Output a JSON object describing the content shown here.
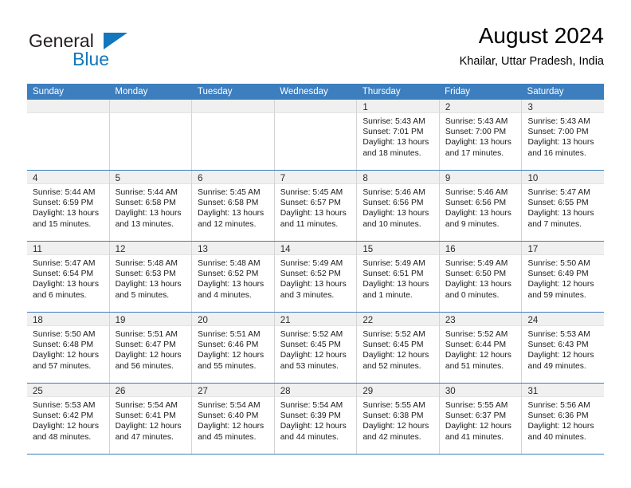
{
  "brand": {
    "name_part1": "General",
    "name_part2": "Blue",
    "logo_icon": "triangle-icon",
    "color_dark": "#231f20",
    "color_blue": "#1277bc"
  },
  "header": {
    "title": "August 2024",
    "subtitle": "Khailar, Uttar Pradesh, India"
  },
  "calendar": {
    "accent_color": "#3d7ebf",
    "daynum_band_color": "#f0f0f0",
    "weekdays": [
      "Sunday",
      "Monday",
      "Tuesday",
      "Wednesday",
      "Thursday",
      "Friday",
      "Saturday"
    ],
    "weeks": [
      [
        {
          "day": "",
          "lines": []
        },
        {
          "day": "",
          "lines": []
        },
        {
          "day": "",
          "lines": []
        },
        {
          "day": "",
          "lines": []
        },
        {
          "day": "1",
          "lines": [
            "Sunrise: 5:43 AM",
            "Sunset: 7:01 PM",
            "Daylight: 13 hours",
            "and 18 minutes."
          ]
        },
        {
          "day": "2",
          "lines": [
            "Sunrise: 5:43 AM",
            "Sunset: 7:00 PM",
            "Daylight: 13 hours",
            "and 17 minutes."
          ]
        },
        {
          "day": "3",
          "lines": [
            "Sunrise: 5:43 AM",
            "Sunset: 7:00 PM",
            "Daylight: 13 hours",
            "and 16 minutes."
          ]
        }
      ],
      [
        {
          "day": "4",
          "lines": [
            "Sunrise: 5:44 AM",
            "Sunset: 6:59 PM",
            "Daylight: 13 hours",
            "and 15 minutes."
          ]
        },
        {
          "day": "5",
          "lines": [
            "Sunrise: 5:44 AM",
            "Sunset: 6:58 PM",
            "Daylight: 13 hours",
            "and 13 minutes."
          ]
        },
        {
          "day": "6",
          "lines": [
            "Sunrise: 5:45 AM",
            "Sunset: 6:58 PM",
            "Daylight: 13 hours",
            "and 12 minutes."
          ]
        },
        {
          "day": "7",
          "lines": [
            "Sunrise: 5:45 AM",
            "Sunset: 6:57 PM",
            "Daylight: 13 hours",
            "and 11 minutes."
          ]
        },
        {
          "day": "8",
          "lines": [
            "Sunrise: 5:46 AM",
            "Sunset: 6:56 PM",
            "Daylight: 13 hours",
            "and 10 minutes."
          ]
        },
        {
          "day": "9",
          "lines": [
            "Sunrise: 5:46 AM",
            "Sunset: 6:56 PM",
            "Daylight: 13 hours",
            "and 9 minutes."
          ]
        },
        {
          "day": "10",
          "lines": [
            "Sunrise: 5:47 AM",
            "Sunset: 6:55 PM",
            "Daylight: 13 hours",
            "and 7 minutes."
          ]
        }
      ],
      [
        {
          "day": "11",
          "lines": [
            "Sunrise: 5:47 AM",
            "Sunset: 6:54 PM",
            "Daylight: 13 hours",
            "and 6 minutes."
          ]
        },
        {
          "day": "12",
          "lines": [
            "Sunrise: 5:48 AM",
            "Sunset: 6:53 PM",
            "Daylight: 13 hours",
            "and 5 minutes."
          ]
        },
        {
          "day": "13",
          "lines": [
            "Sunrise: 5:48 AM",
            "Sunset: 6:52 PM",
            "Daylight: 13 hours",
            "and 4 minutes."
          ]
        },
        {
          "day": "14",
          "lines": [
            "Sunrise: 5:49 AM",
            "Sunset: 6:52 PM",
            "Daylight: 13 hours",
            "and 3 minutes."
          ]
        },
        {
          "day": "15",
          "lines": [
            "Sunrise: 5:49 AM",
            "Sunset: 6:51 PM",
            "Daylight: 13 hours",
            "and 1 minute."
          ]
        },
        {
          "day": "16",
          "lines": [
            "Sunrise: 5:49 AM",
            "Sunset: 6:50 PM",
            "Daylight: 13 hours",
            "and 0 minutes."
          ]
        },
        {
          "day": "17",
          "lines": [
            "Sunrise: 5:50 AM",
            "Sunset: 6:49 PM",
            "Daylight: 12 hours",
            "and 59 minutes."
          ]
        }
      ],
      [
        {
          "day": "18",
          "lines": [
            "Sunrise: 5:50 AM",
            "Sunset: 6:48 PM",
            "Daylight: 12 hours",
            "and 57 minutes."
          ]
        },
        {
          "day": "19",
          "lines": [
            "Sunrise: 5:51 AM",
            "Sunset: 6:47 PM",
            "Daylight: 12 hours",
            "and 56 minutes."
          ]
        },
        {
          "day": "20",
          "lines": [
            "Sunrise: 5:51 AM",
            "Sunset: 6:46 PM",
            "Daylight: 12 hours",
            "and 55 minutes."
          ]
        },
        {
          "day": "21",
          "lines": [
            "Sunrise: 5:52 AM",
            "Sunset: 6:45 PM",
            "Daylight: 12 hours",
            "and 53 minutes."
          ]
        },
        {
          "day": "22",
          "lines": [
            "Sunrise: 5:52 AM",
            "Sunset: 6:45 PM",
            "Daylight: 12 hours",
            "and 52 minutes."
          ]
        },
        {
          "day": "23",
          "lines": [
            "Sunrise: 5:52 AM",
            "Sunset: 6:44 PM",
            "Daylight: 12 hours",
            "and 51 minutes."
          ]
        },
        {
          "day": "24",
          "lines": [
            "Sunrise: 5:53 AM",
            "Sunset: 6:43 PM",
            "Daylight: 12 hours",
            "and 49 minutes."
          ]
        }
      ],
      [
        {
          "day": "25",
          "lines": [
            "Sunrise: 5:53 AM",
            "Sunset: 6:42 PM",
            "Daylight: 12 hours",
            "and 48 minutes."
          ]
        },
        {
          "day": "26",
          "lines": [
            "Sunrise: 5:54 AM",
            "Sunset: 6:41 PM",
            "Daylight: 12 hours",
            "and 47 minutes."
          ]
        },
        {
          "day": "27",
          "lines": [
            "Sunrise: 5:54 AM",
            "Sunset: 6:40 PM",
            "Daylight: 12 hours",
            "and 45 minutes."
          ]
        },
        {
          "day": "28",
          "lines": [
            "Sunrise: 5:54 AM",
            "Sunset: 6:39 PM",
            "Daylight: 12 hours",
            "and 44 minutes."
          ]
        },
        {
          "day": "29",
          "lines": [
            "Sunrise: 5:55 AM",
            "Sunset: 6:38 PM",
            "Daylight: 12 hours",
            "and 42 minutes."
          ]
        },
        {
          "day": "30",
          "lines": [
            "Sunrise: 5:55 AM",
            "Sunset: 6:37 PM",
            "Daylight: 12 hours",
            "and 41 minutes."
          ]
        },
        {
          "day": "31",
          "lines": [
            "Sunrise: 5:56 AM",
            "Sunset: 6:36 PM",
            "Daylight: 12 hours",
            "and 40 minutes."
          ]
        }
      ]
    ]
  }
}
